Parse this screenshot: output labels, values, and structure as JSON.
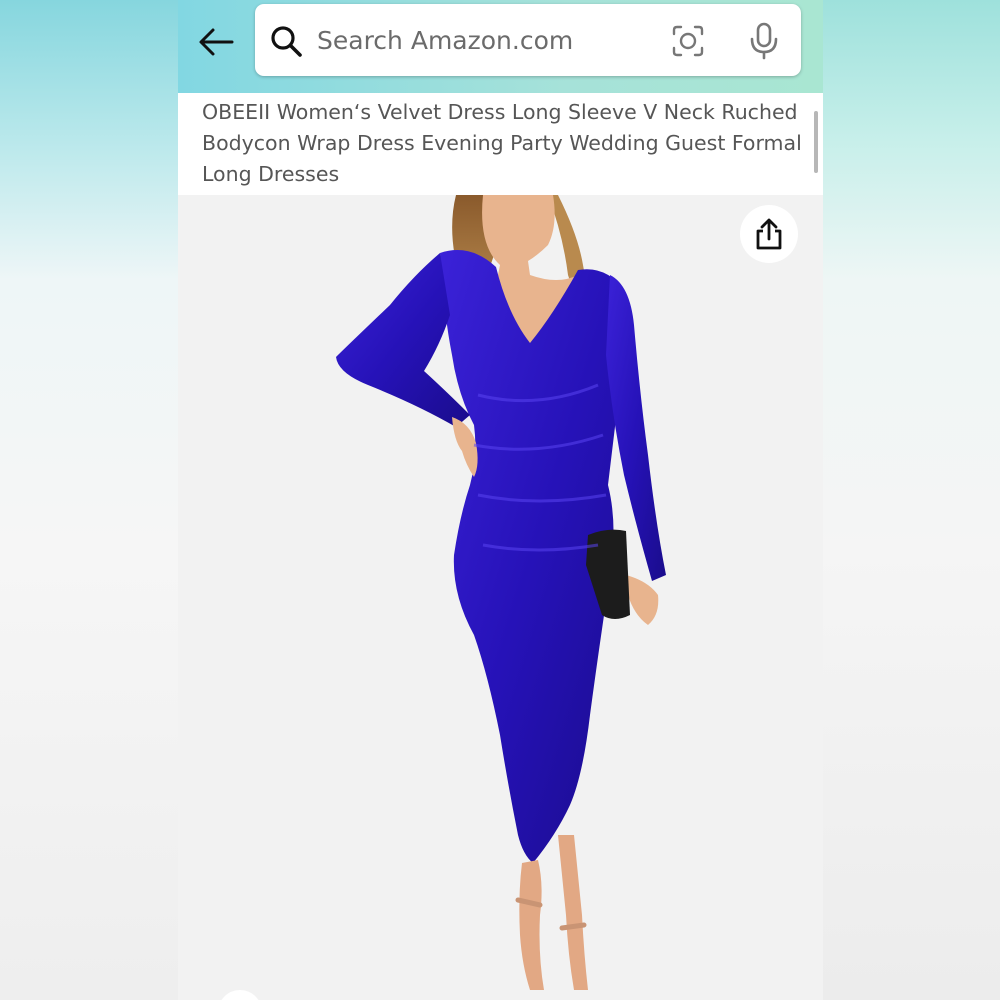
{
  "search": {
    "placeholder": "Search Amazon.com"
  },
  "icons": {
    "back": "back-arrow-icon",
    "search": "search-icon",
    "camera": "camera-lens-icon",
    "mic": "microphone-icon",
    "share": "share-icon"
  },
  "product": {
    "title": "OBEEII Women‘s Velvet Dress Long Sleeve V Neck Ruched Bodycon Wrap Dress Evening Party Wedding Guest Formal Long Dresses",
    "dress_color": "#2a14c2"
  },
  "colors": {
    "header_start": "#82d7e2",
    "header_end": "#a9e6d2",
    "title_text": "#565656",
    "image_bg": "#f2f2f2"
  }
}
